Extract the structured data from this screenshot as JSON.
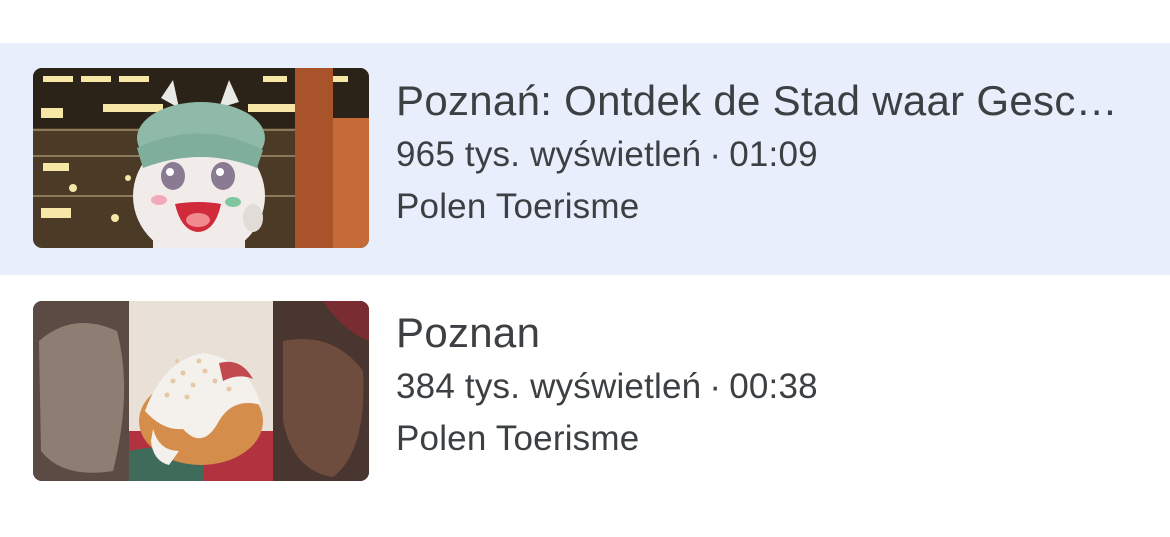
{
  "videos": [
    {
      "title": "Poznań: Ontdek de Stad waar Gesc…",
      "views": "965 tys. wyświetleń",
      "separator": "·",
      "duration": "01:09",
      "channel": "Polen Toerisme",
      "selected": true,
      "thumbnail_icon": "mascot-thumbnail"
    },
    {
      "title": "Poznan",
      "views": "384 tys. wyświetleń",
      "separator": "·",
      "duration": "00:38",
      "channel": "Polen Toerisme",
      "selected": false,
      "thumbnail_icon": "pastry-thumbnail"
    }
  ],
  "colors": {
    "selected_row_bg": "#e8eefb",
    "text": "#3c4043",
    "background": "#ffffff"
  }
}
